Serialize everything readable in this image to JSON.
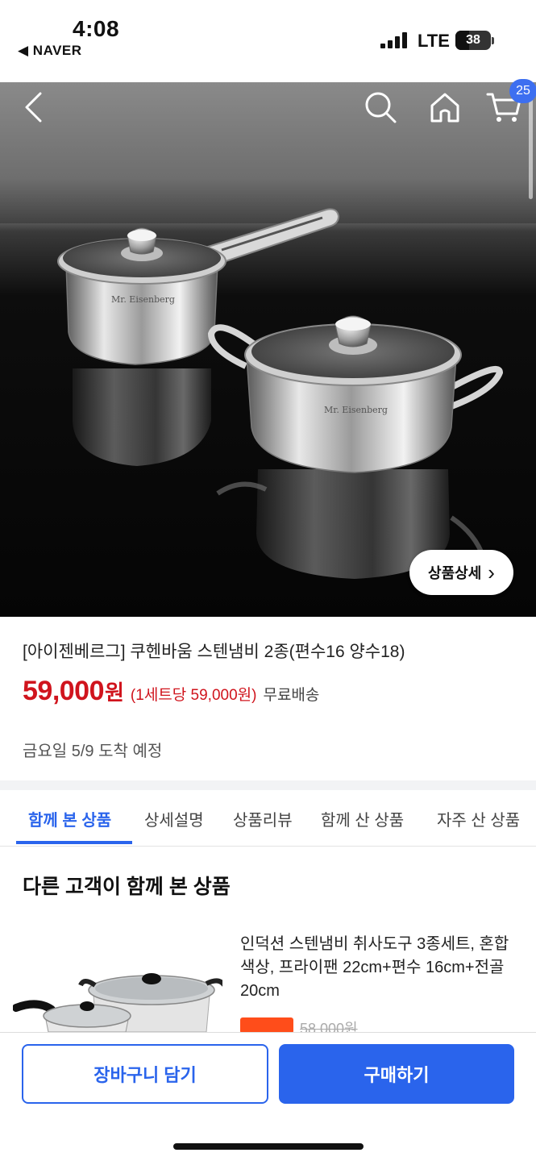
{
  "status_bar": {
    "time": "4:08",
    "back_app": "◀ NAVER",
    "network": "LTE",
    "battery": "38",
    "battery_level": 0.38
  },
  "header": {
    "cart_count": "25",
    "icons": [
      "back-arrow-icon",
      "search-icon",
      "home-icon",
      "cart-icon"
    ]
  },
  "hero": {
    "detail_button": "상품상세",
    "detail_chevron": "›",
    "pot_label": "Mr. Eisenberg"
  },
  "product": {
    "title": "[아이젠베르그] 쿠헨바움 스텐냄비 2종(편수16 양수18)",
    "price": "59,000",
    "price_unit": "원",
    "per_set": "(1세트당 59,000원)",
    "shipping": "무료배송",
    "arrival": "금요일 5/9 도착 예정"
  },
  "tabs": [
    {
      "label": "함께 본 상품",
      "active": true
    },
    {
      "label": "상세설명",
      "active": false
    },
    {
      "label": "상품리뷰",
      "active": false
    },
    {
      "label": "함께 산 상품",
      "active": false
    },
    {
      "label": "자주 산 상품",
      "active": false
    }
  ],
  "recommendations": {
    "section_title": "다른 고객이 함께 본 상품",
    "items": [
      {
        "name": "인덕션 스텐냄비 취사도구 3종세트, 혼합색상, 프라이팬 22cm+편수 16cm+전골 20cm",
        "original_price": "58,000원"
      }
    ]
  },
  "bottom_bar": {
    "add_to_cart": "장바구니 담기",
    "buy_now": "구매하기"
  },
  "colors": {
    "accent": "#2a64ec",
    "price": "#d0141d",
    "badge": "#3d6ff0"
  }
}
